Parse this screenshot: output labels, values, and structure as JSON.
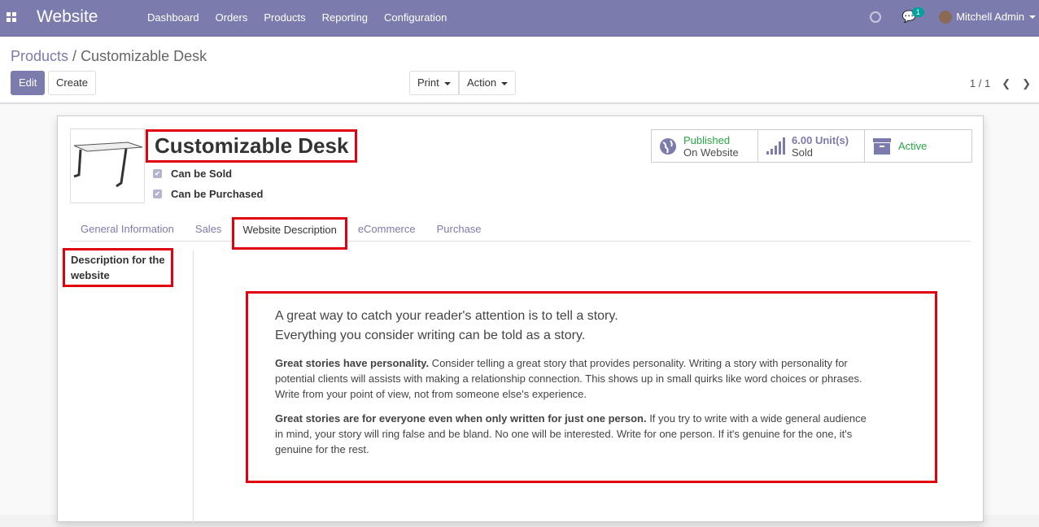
{
  "nav": {
    "brand": "Website",
    "menu": [
      "Dashboard",
      "Orders",
      "Products",
      "Reporting",
      "Configuration"
    ],
    "chat_count": "1",
    "user": "Mitchell Admin"
  },
  "breadcrumb": {
    "parent": "Products",
    "current": "Customizable Desk"
  },
  "buttons": {
    "edit": "Edit",
    "create": "Create",
    "print": "Print",
    "action": "Action"
  },
  "pager": {
    "value": "1 / 1"
  },
  "product": {
    "name": "Customizable Desk",
    "can_be_sold": "Can be Sold",
    "can_be_purchased": "Can be Purchased"
  },
  "stats": {
    "published": "Published",
    "on_website": "On Website",
    "sold_qty": "6.00",
    "sold_unit": "Unit(s)",
    "sold": "Sold",
    "active": "Active"
  },
  "tabs": [
    "General Information",
    "Sales",
    "Website Description",
    "eCommerce",
    "Purchase"
  ],
  "field_label": "Description for the website",
  "description": {
    "lead1": "A great way to catch your reader's attention is to tell a story.",
    "lead2": "Everything you consider writing can be told as a story.",
    "p1_bold": "Great stories have personality.",
    "p1": " Consider telling a great story that provides personality. Writing a story with personality for potential clients will assists with making a relationship connection. This shows up in small quirks like word choices or phrases. Write from your point of view, not from someone else's experience.",
    "p2_bold": "Great stories are for everyone even when only written for just one person.",
    "p2": " If you try to write with a wide general audience in mind, your story will ring false and be bland. No one will be interested. Write for one person. If it's genuine for the one, it's genuine for the rest."
  }
}
